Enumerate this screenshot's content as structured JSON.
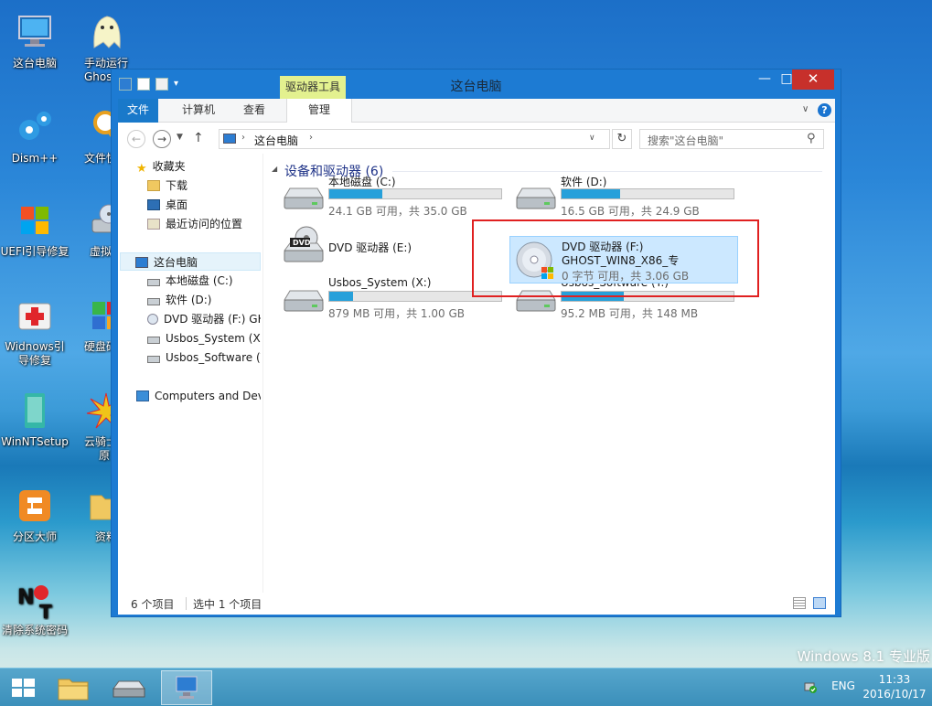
{
  "desktop": {
    "icons": [
      {
        "label": "这台电脑"
      },
      {
        "label": "手动运行"
      },
      {
        "label": "Ghos"
      },
      {
        "label": "Dism++"
      },
      {
        "label": "文件快速"
      },
      {
        "label": "UEFI引导修复"
      },
      {
        "label": "虚拟驱"
      },
      {
        "label": "Widnows引"
      },
      {
        "label": "导修复"
      },
      {
        "label": "硬盘碎片"
      },
      {
        "label": "WinNTSetup"
      },
      {
        "label": "云骑士一"
      },
      {
        "label": "原"
      },
      {
        "label": "分区大师"
      },
      {
        "label": "资料"
      },
      {
        "label": "清除系统密码"
      }
    ],
    "watermark": "Windows 8.1 专业版"
  },
  "window": {
    "title": "这台电脑",
    "context_tab": "驱动器工具",
    "controls": {
      "minimize": "—",
      "maximize": "□",
      "close": "✕"
    },
    "ribbon_tabs": [
      {
        "label": "文件"
      },
      {
        "label": "计算机"
      },
      {
        "label": "查看"
      },
      {
        "label": "管理"
      }
    ],
    "address": {
      "path": [
        "这台电脑"
      ],
      "search_placeholder": "搜索\"这台电脑\""
    },
    "nav": {
      "items": [
        {
          "label": "收藏夹"
        },
        {
          "label": "下载"
        },
        {
          "label": "桌面"
        },
        {
          "label": "最近访问的位置"
        },
        {
          "label": "这台电脑"
        },
        {
          "label": "本地磁盘 (C:)"
        },
        {
          "label": "软件 (D:)"
        },
        {
          "label": "DVD 驱动器 (F:) GH"
        },
        {
          "label": "Usbos_System (X:)"
        },
        {
          "label": "Usbos_Software (Y"
        },
        {
          "label": "Computers and Dev"
        }
      ]
    },
    "group": {
      "title": "设备和驱动器 (6)"
    },
    "drives": [
      {
        "name": "本地磁盘 (C:)",
        "free": "24.1 GB 可用，共 35.0 GB",
        "used_fraction": 0.31
      },
      {
        "name": "软件 (D:)",
        "free": "16.5 GB 可用，共 24.9 GB",
        "used_fraction": 0.34
      },
      {
        "name": "DVD 驱动器 (E:)"
      },
      {
        "name": "DVD 驱动器 (F:)",
        "label": "GHOST_WIN8_X86_专",
        "free": "0 字节 可用，共 3.06 GB"
      },
      {
        "name": "Usbos_System (X:)",
        "free": "879 MB 可用，共 1.00 GB",
        "used_fraction": 0.14
      },
      {
        "name": "Usbos_Software (Y:)",
        "free": "95.2 MB 可用，共 148 MB",
        "used_fraction": 0.36
      }
    ],
    "status": {
      "count": "6 个项目",
      "selected": "选中 1 个项目"
    }
  },
  "taskbar": {
    "lang": "ENG",
    "time": "11:33",
    "date": "2016/10/17"
  },
  "colors": {
    "accent": "#1979ca",
    "selection": "#cce8ff",
    "progress": "#26a0da",
    "highlight_box": "#e02020"
  }
}
